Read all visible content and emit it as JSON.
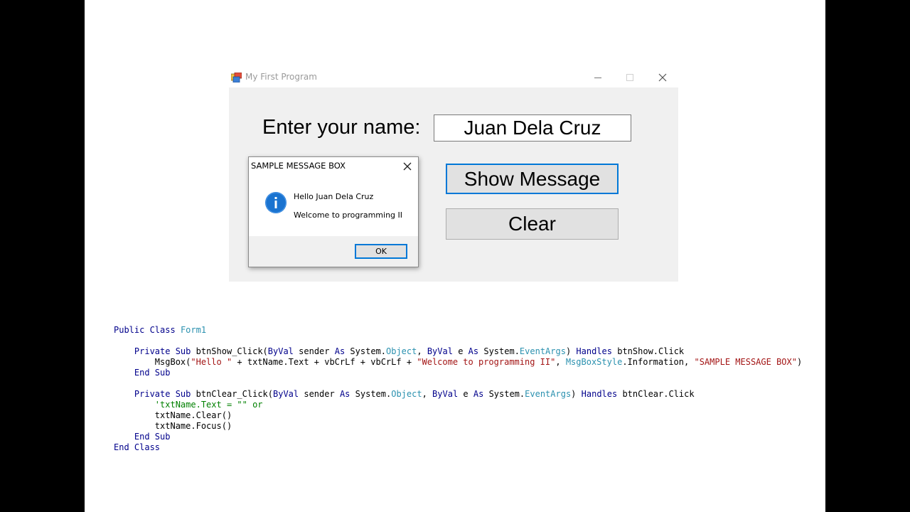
{
  "window": {
    "title": "My First Program",
    "label_name": "Enter your name:",
    "name_value": "Juan Dela Cruz",
    "show_button": "Show Message",
    "clear_button": "Clear"
  },
  "msgbox": {
    "title": "SAMPLE MESSAGE BOX",
    "line1": "Hello Juan Dela Cruz",
    "line2": "Welcome to programming II",
    "ok_label": "OK"
  },
  "code": {
    "l1": [
      "Public Class",
      "Form1"
    ],
    "l3": [
      "Private Sub",
      "btnShow_Click(",
      "ByVal",
      "sender",
      "As",
      "System.",
      "Object",
      ",",
      "ByVal",
      "e",
      "As",
      "System.",
      "EventArgs",
      ")",
      "Handles",
      "btnShow.Click"
    ],
    "l4": [
      "MsgBox(",
      "\"Hello \"",
      "+ txtName.Text + vbCrLf + vbCrLf +",
      "\"Welcome to programming II\"",
      ",",
      "MsgBoxStyle",
      ".Information,",
      "\"SAMPLE MESSAGE BOX\"",
      ")"
    ],
    "l5": [
      "End Sub"
    ],
    "l7": [
      "Private Sub",
      "btnClear_Click(",
      "ByVal",
      "sender",
      "As",
      "System.",
      "Object",
      ",",
      "ByVal",
      "e",
      "As",
      "System.",
      "EventArgs",
      ")",
      "Handles",
      "btnClear.Click"
    ],
    "l8": [
      "'txtName.Text = \"\" or"
    ],
    "l9": [
      "txtName.Clear()"
    ],
    "l10": [
      "txtName.Focus()"
    ],
    "l11": [
      "End Sub"
    ],
    "l12": [
      "End Class"
    ]
  },
  "colors": {
    "keyword": "#00008b",
    "type": "#2b91af",
    "string": "#a31515",
    "comment": "#008000",
    "focus_border": "#0078d7",
    "info_icon": "#1a73d0"
  }
}
